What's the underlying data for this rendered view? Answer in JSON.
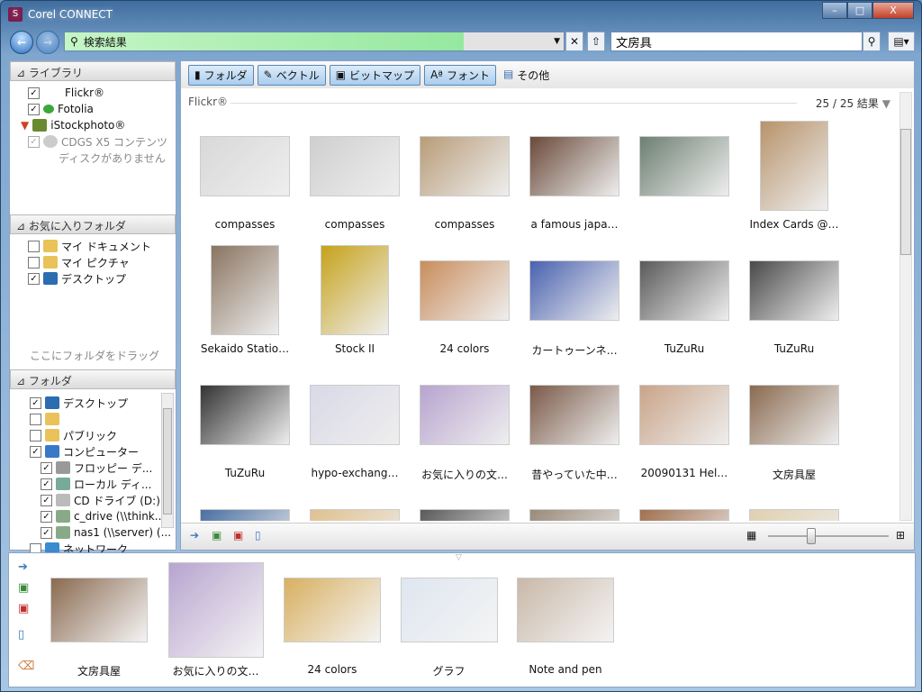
{
  "window": {
    "title": "Corel CONNECT",
    "minimize": "–",
    "maximize": "□",
    "close": "X"
  },
  "address": {
    "value": "検索結果",
    "search_value": "文房具"
  },
  "library": {
    "header": "ライブラリ",
    "items": [
      {
        "label": "Flickr®",
        "checked": true
      },
      {
        "label": "Fotolia",
        "checked": true
      },
      {
        "label": "iStockphoto®",
        "checked": false
      },
      {
        "label": "CDGS X5 コンテンツ",
        "checked": true,
        "disabled": true
      },
      {
        "label": "ディスクがありません",
        "disabled": true
      }
    ]
  },
  "favorites": {
    "header": "お気に入りフォルダ",
    "items": [
      {
        "label": "マイ ドキュメント",
        "checked": false
      },
      {
        "label": "マイ ピクチャ",
        "checked": false
      },
      {
        "label": "デスクトップ",
        "checked": true
      }
    ],
    "drop_hint": "ここにフォルダをドラッグ"
  },
  "folders": {
    "header": "フォルダ",
    "items": [
      {
        "label": "デスクトップ",
        "checked": true,
        "level": 0
      },
      {
        "label": "",
        "checked": false,
        "level": 0
      },
      {
        "label": "パブリック",
        "checked": false,
        "level": 0
      },
      {
        "label": "コンピューター",
        "checked": true,
        "level": 0
      },
      {
        "label": "フロッピー デ...",
        "checked": true,
        "level": 1
      },
      {
        "label": "ローカル ディ...",
        "checked": true,
        "level": 1
      },
      {
        "label": "CD ドライブ (D:)",
        "checked": true,
        "level": 1
      },
      {
        "label": "c_drive (\\\\think...",
        "checked": true,
        "level": 1
      },
      {
        "label": "nas1 (\\\\server) (...",
        "checked": true,
        "level": 1
      },
      {
        "label": "ネットワーク",
        "checked": false,
        "level": 0
      }
    ]
  },
  "filters": {
    "folder": "フォルダ",
    "vector": "ベクトル",
    "bitmap": "ビットマップ",
    "font": "フォント",
    "other": "その他"
  },
  "results": {
    "source": "Flickr®",
    "count": "25 / 25 結果"
  },
  "items": [
    {
      "label": "compasses",
      "color": "#d8d8d8"
    },
    {
      "label": "compasses",
      "color": "#cfcfcf"
    },
    {
      "label": "compasses",
      "color": "#b89c78"
    },
    {
      "label": "a famous japa…",
      "color": "#6a4a3a"
    },
    {
      "label": "",
      "color": "#6d7f72"
    },
    {
      "label": "Index Cards @…",
      "color": "#b7936a"
    },
    {
      "label": "Sekaido Statio…",
      "color": "#8a7460"
    },
    {
      "label": "Stock II",
      "color": "#c6a21a"
    },
    {
      "label": "24 colors",
      "color": "#c98d5c"
    },
    {
      "label": "カートゥーンネ…",
      "color": "#4a62b0"
    },
    {
      "label": "TuZuRu",
      "color": "#5a5a5a"
    },
    {
      "label": "TuZuRu",
      "color": "#4a4a4a"
    },
    {
      "label": "TuZuRu",
      "color": "#333333"
    },
    {
      "label": "hypo-exchang…",
      "color": "#d9d9e8"
    },
    {
      "label": "お気に入りの文…",
      "color": "#b8a4cf"
    },
    {
      "label": "昔やっていた中…",
      "color": "#7a5a48"
    },
    {
      "label": "20090131 Hel…",
      "color": "#c9a488"
    },
    {
      "label": "文房具屋",
      "color": "#8a6a50"
    },
    {
      "label": "",
      "color": "#4a6fa0"
    },
    {
      "label": "",
      "color": "#e0c090"
    },
    {
      "label": "",
      "color": "#5a5a5a"
    },
    {
      "label": "",
      "color": "#9a8a7a"
    },
    {
      "label": "",
      "color": "#a07050"
    },
    {
      "label": "",
      "color": "#e0d0b0"
    }
  ],
  "tray": [
    {
      "label": "文房具屋",
      "color": "#8a6a50"
    },
    {
      "label": "お気に入りの文…",
      "color": "#b8a4cf"
    },
    {
      "label": "24 colors",
      "color": "#d8b060"
    },
    {
      "label": "グラフ",
      "color": "#dfe6f0"
    },
    {
      "label": "Note and pen",
      "color": "#c9b8a8"
    }
  ],
  "zoom_level": 0.35
}
